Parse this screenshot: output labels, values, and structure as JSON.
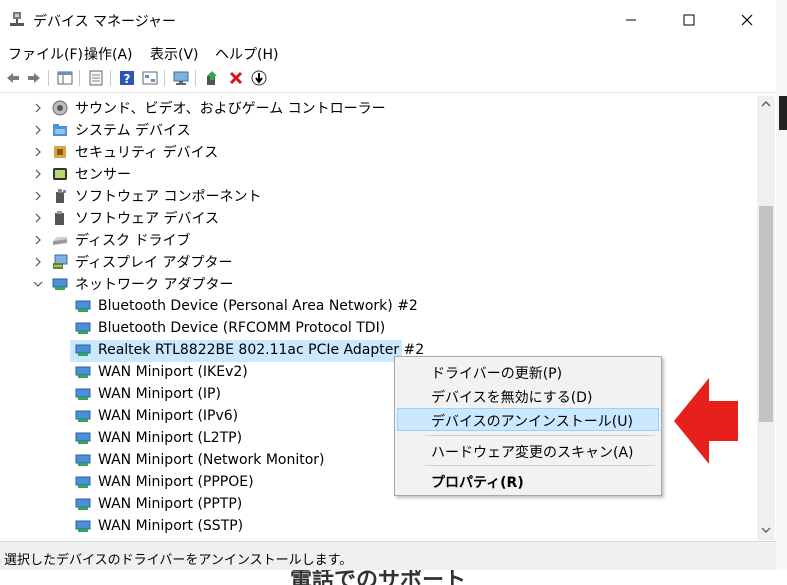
{
  "window": {
    "title": "デバイス マネージャー"
  },
  "menu": [
    "ファイル(F)",
    "操作(A)",
    "表示(V)",
    "ヘルプ(H)"
  ],
  "tree": {
    "categories": [
      {
        "label": "サウンド、ビデオ、およびゲーム コントローラー",
        "icon": "speaker-icon"
      },
      {
        "label": "システム デバイス",
        "icon": "system-folder-icon"
      },
      {
        "label": "セキュリティ デバイス",
        "icon": "security-device-icon"
      },
      {
        "label": "センサー",
        "icon": "sensor-icon"
      },
      {
        "label": "ソフトウェア コンポーネント",
        "icon": "software-component-icon"
      },
      {
        "label": "ソフトウェア デバイス",
        "icon": "software-device-icon"
      },
      {
        "label": "ディスク ドライブ",
        "icon": "disk-drive-icon"
      },
      {
        "label": "ディスプレイ アダプター",
        "icon": "display-adapter-icon"
      },
      {
        "label": "ネットワーク アダプター",
        "icon": "network-adapter-icon"
      }
    ],
    "network_devices": [
      "Bluetooth Device (Personal Area Network) #2",
      "Bluetooth Device (RFCOMM Protocol TDI)",
      "Realtek RTL8822BE 802.11ac PCIe Adapter #2",
      "WAN Miniport (IKEv2)",
      "WAN Miniport (IP)",
      "WAN Miniport (IPv6)",
      "WAN Miniport (L2TP)",
      "WAN Miniport (Network Monitor)",
      "WAN Miniport (PPPOE)",
      "WAN Miniport (PPTP)",
      "WAN Miniport (SSTP)"
    ],
    "selected_index": 2
  },
  "context_menu": {
    "items": [
      "ドライバーの更新(P)",
      "デバイスを無効にする(D)",
      "デバイスのアンインストール(U)",
      "ハードウェア変更のスキャン(A)",
      "プロパティ(R)"
    ],
    "highlighted_index": 2
  },
  "status": "選択したデバイスのドライバーをアンインストールします。",
  "background_text": "電話でのサポート",
  "colors": {
    "arrow": "#e8201c",
    "selection": "#cce8ff",
    "highlight_border": "#99d1ff"
  }
}
